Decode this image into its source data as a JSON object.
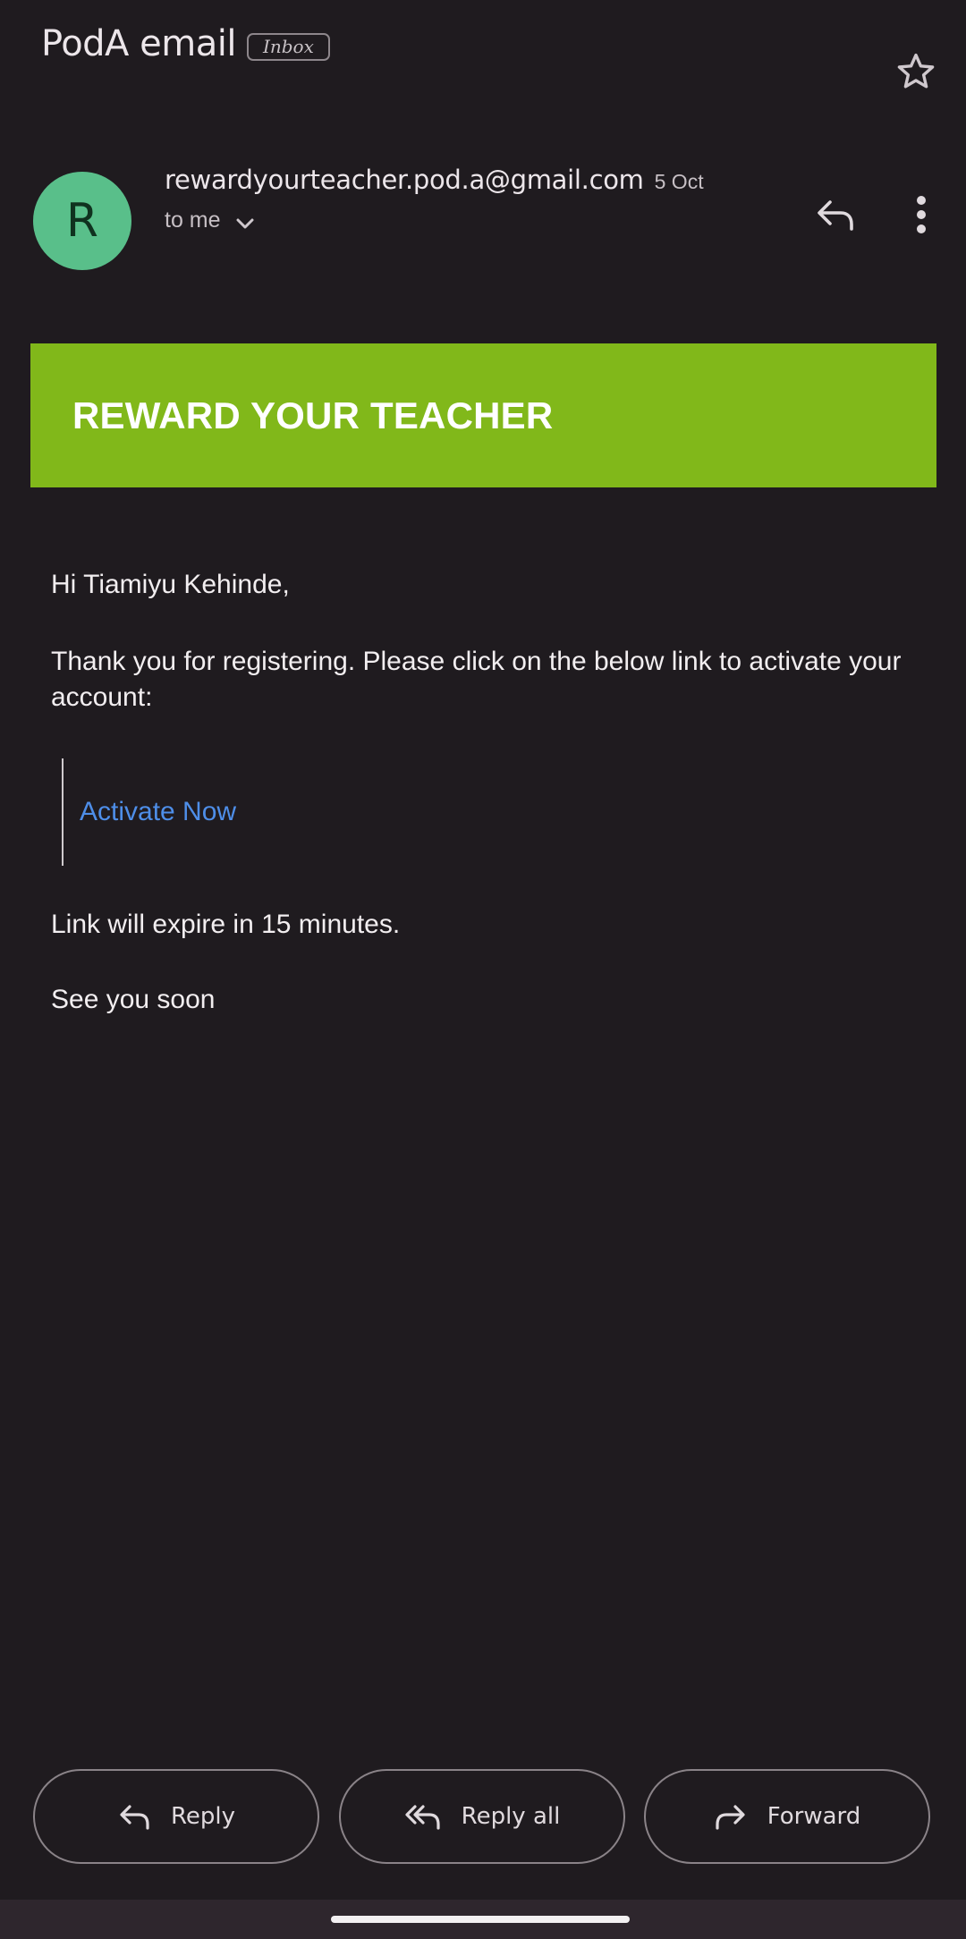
{
  "header": {
    "subject": "PodA email",
    "label": "Inbox"
  },
  "message": {
    "avatar_letter": "R",
    "sender_email": "rewardyourteacher.pod.a@gmail.com",
    "date": "5 Oct",
    "recipient": "to me"
  },
  "banner": {
    "title": "REWARD YOUR TEACHER",
    "background": "#81b81a"
  },
  "body": {
    "greeting": "Hi Tiamiyu Kehinde,",
    "paragraph": "Thank you for registering. Please click on the below link to activate your account:",
    "link_label": "Activate Now",
    "expiry": "Link will expire in 15 minutes.",
    "signoff": "See you soon"
  },
  "actions": {
    "reply_label": "Reply",
    "reply_all_label": "Reply all",
    "forward_label": "Forward"
  },
  "icons": {
    "star": "star-icon",
    "reply": "reply-icon",
    "more": "more-vert-icon",
    "chevron": "chevron-down-icon",
    "reply_all": "reply-all-icon",
    "forward": "forward-icon"
  },
  "colors": {
    "background": "#1f1b1f",
    "avatar": "#59bf8a",
    "link": "#4e8ee8"
  }
}
